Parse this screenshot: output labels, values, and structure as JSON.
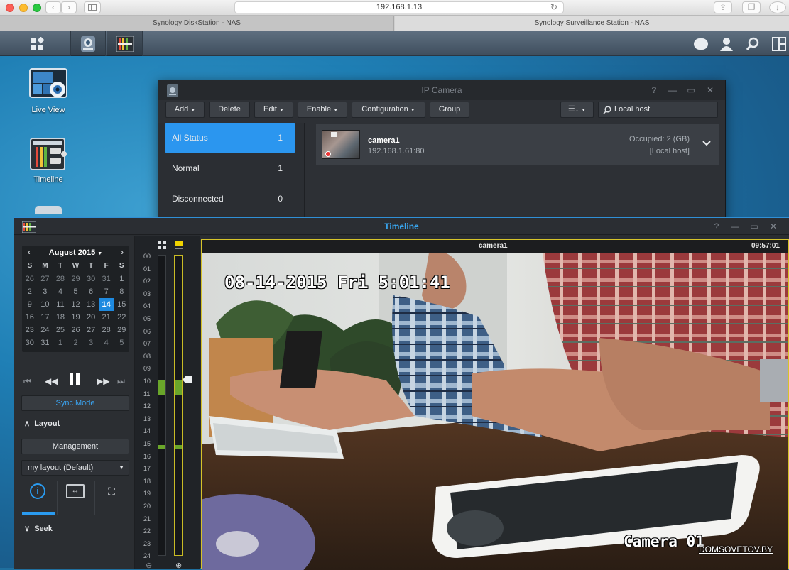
{
  "browser": {
    "url": "192.168.1.13",
    "tabs": [
      "Synology DiskStation - NAS",
      "Synology Surveillance Station - NAS"
    ]
  },
  "desktop_icons": [
    "Live View",
    "Timeline"
  ],
  "ip_camera": {
    "title": "IP Camera",
    "toolbar": {
      "add": "Add",
      "delete": "Delete",
      "edit": "Edit",
      "enable": "Enable",
      "configuration": "Configuration",
      "group": "Group",
      "search_value": "Local host"
    },
    "status_list": [
      {
        "label": "All Status",
        "count": "1"
      },
      {
        "label": "Normal",
        "count": "1"
      },
      {
        "label": "Disconnected",
        "count": "0"
      }
    ],
    "camera": {
      "name": "camera1",
      "address": "192.168.1.61:80",
      "occupied": "Occupied: 2 (GB)",
      "host": "[Local host]"
    }
  },
  "timeline": {
    "title": "Timeline",
    "calendar": {
      "month": "August 2015",
      "weekdays": [
        "S",
        "M",
        "T",
        "W",
        "T",
        "F",
        "S"
      ],
      "weeks": [
        [
          "26",
          "27",
          "28",
          "29",
          "30",
          "31",
          "1"
        ],
        [
          "2",
          "3",
          "4",
          "5",
          "6",
          "7",
          "8"
        ],
        [
          "9",
          "10",
          "11",
          "12",
          "13",
          "14",
          "15"
        ],
        [
          "16",
          "17",
          "18",
          "19",
          "20",
          "21",
          "22"
        ],
        [
          "23",
          "24",
          "25",
          "26",
          "27",
          "28",
          "29"
        ],
        [
          "30",
          "31",
          "1",
          "2",
          "3",
          "4",
          "5"
        ]
      ],
      "selected_day": "14"
    },
    "sync_mode": "Sync Mode",
    "layout_header": "Layout",
    "management": "Management",
    "layout_select": "my layout (Default)",
    "seek_header": "Seek",
    "hours": [
      "00",
      "01",
      "02",
      "03",
      "04",
      "05",
      "06",
      "07",
      "08",
      "09",
      "10",
      "11",
      "12",
      "13",
      "14",
      "15",
      "16",
      "17",
      "18",
      "19",
      "20",
      "21",
      "22",
      "23",
      "24"
    ],
    "video": {
      "camera_name": "camera1",
      "clock": "09:57:01",
      "osd_datetime": "08-14-2015 Fri  5:01:41",
      "osd_camera": "Camera 01"
    }
  },
  "watermark": "DOMSOVETOV.BY",
  "colors": {
    "accent": "#1e8ae0",
    "record_green": "#6aa62a",
    "selection_border": "#d6c32a"
  }
}
